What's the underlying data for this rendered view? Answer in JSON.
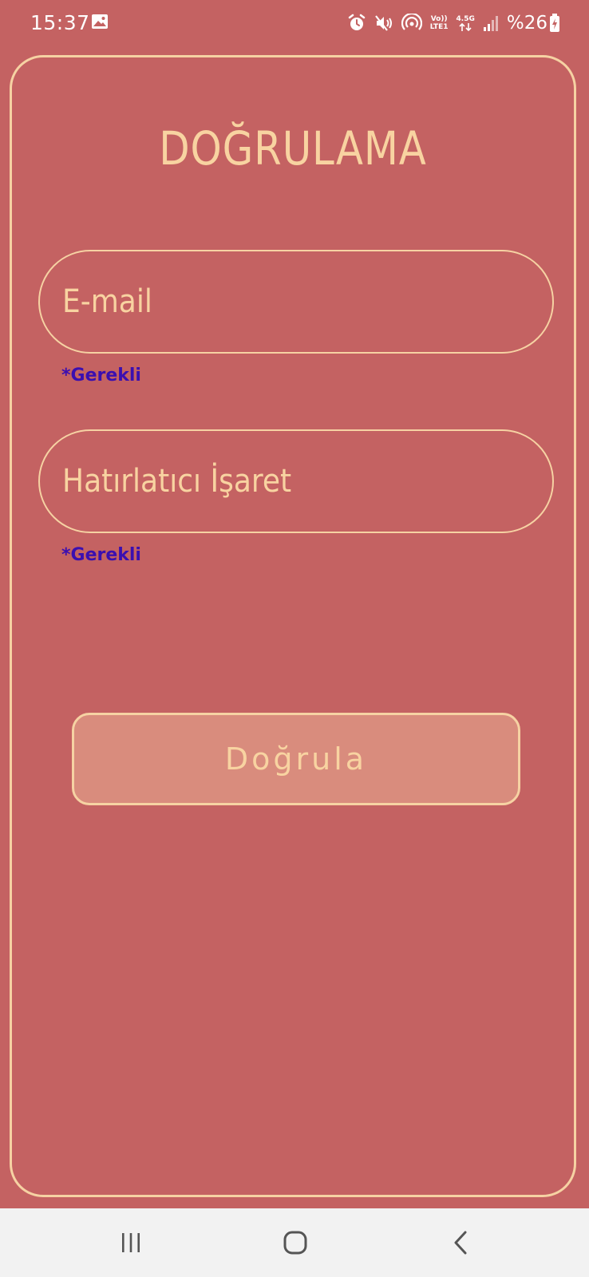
{
  "status_bar": {
    "time": "15:37",
    "icons": [
      "gallery-icon",
      "alarm-icon",
      "mute-icon",
      "hotspot-icon",
      "volte-icon",
      "data-4-5g-icon",
      "signal-icon",
      "battery-icon"
    ],
    "volte_line1": "Vo))",
    "volte_line2": "LTE1",
    "data_label": "4.5G",
    "battery_text": "%26"
  },
  "form": {
    "title": "DOĞRULAMA",
    "email_placeholder": "E-mail",
    "email_required": "*Gerekli",
    "hint_placeholder": "Hatırlatıcı İşaret",
    "hint_required": "*Gerekli",
    "verify_label": "Doğrula"
  },
  "nav_bar": {
    "icons": [
      "recent-apps-icon",
      "home-icon",
      "back-icon"
    ]
  },
  "colors": {
    "background": "#c46262",
    "accent": "#f6d2a3",
    "required_text": "#3b0fb0",
    "button_fill": "#d98c7d",
    "nav_background": "#f2f2f2"
  }
}
